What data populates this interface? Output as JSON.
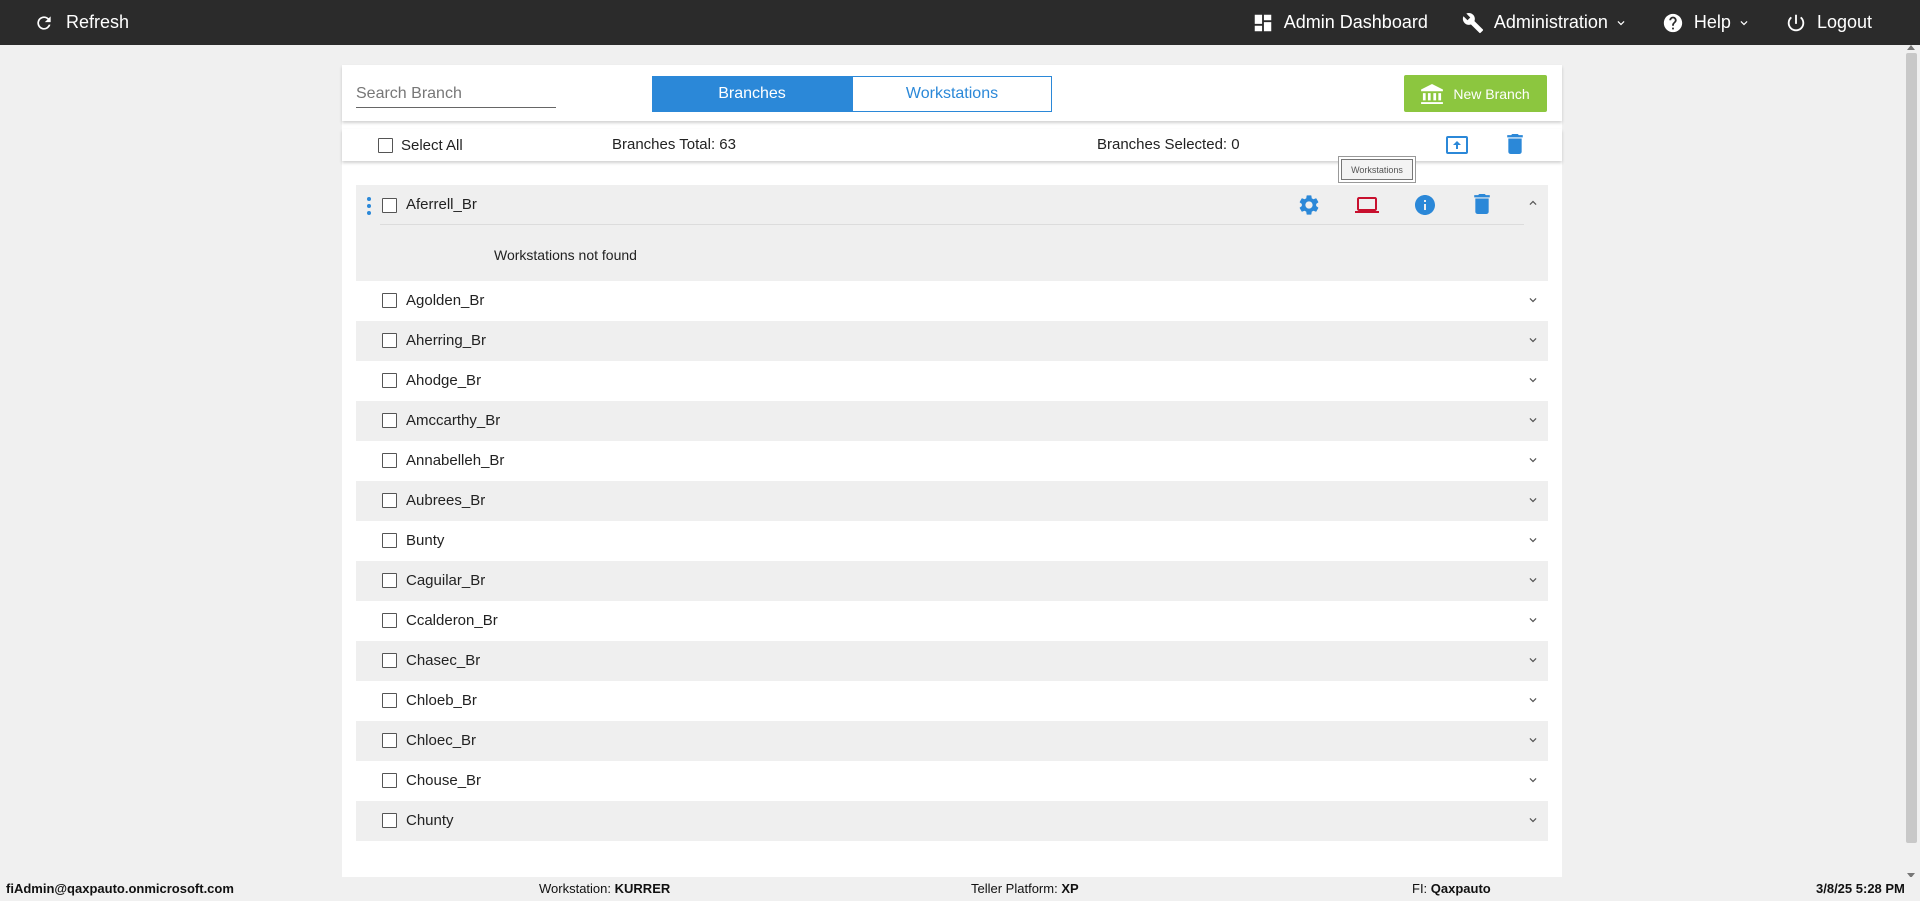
{
  "topbar": {
    "refresh_label": "Refresh",
    "admin_dashboard_label": "Admin Dashboard",
    "administration_label": "Administration",
    "help_label": "Help",
    "logout_label": "Logout"
  },
  "header": {
    "search_placeholder": "Search Branch",
    "tabs": [
      {
        "label": "Branches",
        "active": true
      },
      {
        "label": "Workstations",
        "active": false
      }
    ],
    "new_branch_label": "New Branch"
  },
  "selection_bar": {
    "select_all_label": "Select All",
    "total_text": "Branches Total: 63",
    "selected_text": "Branches Selected: 0"
  },
  "tooltip": "Workstations",
  "expanded_branch": {
    "name": "Aferrell_Br",
    "empty_message": "Workstations not found"
  },
  "branches": [
    "Agolden_Br",
    "Aherring_Br",
    "Ahodge_Br",
    "Amccarthy_Br",
    "Annabelleh_Br",
    "Aubrees_Br",
    "Bunty",
    "Caguilar_Br",
    "Ccalderon_Br",
    "Chasec_Br",
    "Chloeb_Br",
    "Chloec_Br",
    "Chouse_Br",
    "Chunty"
  ],
  "footer": {
    "user": "fiAdmin@qaxpauto.onmicrosoft.com",
    "workstation_label": "Workstation:",
    "workstation_value": "KURRER",
    "platform_label": "Teller Platform:",
    "platform_value": "XP",
    "fi_label": "FI:",
    "fi_value": "Qaxpauto",
    "datetime": "3/8/25 5:28 PM"
  },
  "colors": {
    "accent": "#2b88d8",
    "new_branch": "#8cc63f",
    "workstation_icon": "#c8102e",
    "topbar": "#2b2b2b"
  }
}
